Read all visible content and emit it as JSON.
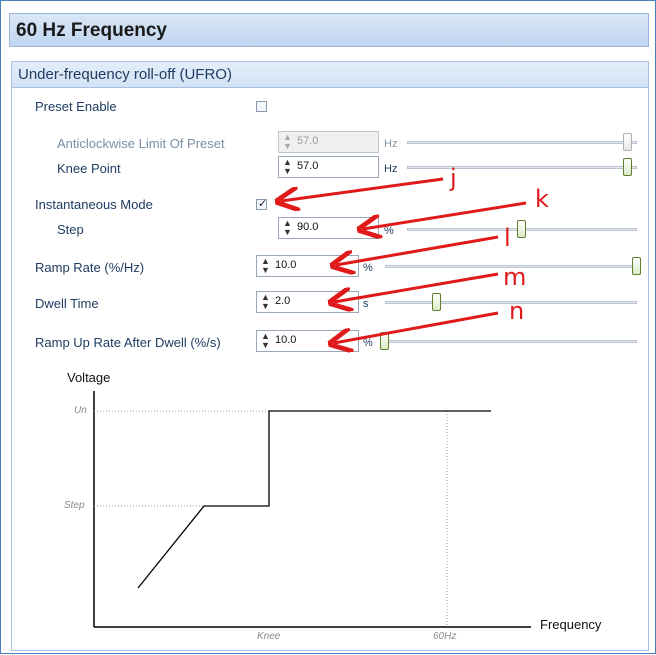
{
  "window": {
    "title": "60 Hz Frequency"
  },
  "section": {
    "title": "Under-frequency roll-off (UFRO)"
  },
  "rows": {
    "preset_enable": {
      "label": "Preset Enable",
      "checked": false
    },
    "anticlockwise": {
      "label": "Anticlockwise Limit Of Preset",
      "value": "57.0",
      "unit": "Hz",
      "slider_fraction": 0.98
    },
    "knee_point": {
      "label": "Knee Point",
      "value": "57.0",
      "unit": "Hz",
      "slider_fraction": 0.98
    },
    "instantaneous": {
      "label": "Instantaneous Mode",
      "checked": true
    },
    "step": {
      "label": "Step",
      "value": "90.0",
      "unit": "%",
      "slider_fraction": 0.48
    },
    "ramp_rate": {
      "label": "Ramp Rate (%/Hz)",
      "value": "10.0",
      "unit": "%",
      "slider_fraction": 1.0
    },
    "dwell_time": {
      "label": "Dwell Time",
      "value": "2.0",
      "unit": "s",
      "slider_fraction": 0.2
    },
    "ramp_up": {
      "label": "Ramp Up Rate After Dwell (%/s)",
      "value": "10.0",
      "unit": "%",
      "slider_fraction": 0.0
    }
  },
  "annotations": [
    "j",
    "k",
    "l",
    "m",
    "n"
  ],
  "graph": {
    "y_label": "Voltage",
    "x_label": "Frequency",
    "y_ticks": [
      "Un",
      "Step"
    ],
    "x_ticks": [
      "Knee",
      "60Hz"
    ]
  },
  "colors": {
    "accent": "#4a7ebb",
    "arrow": "#e01a1a",
    "label": "#1f3d63"
  }
}
